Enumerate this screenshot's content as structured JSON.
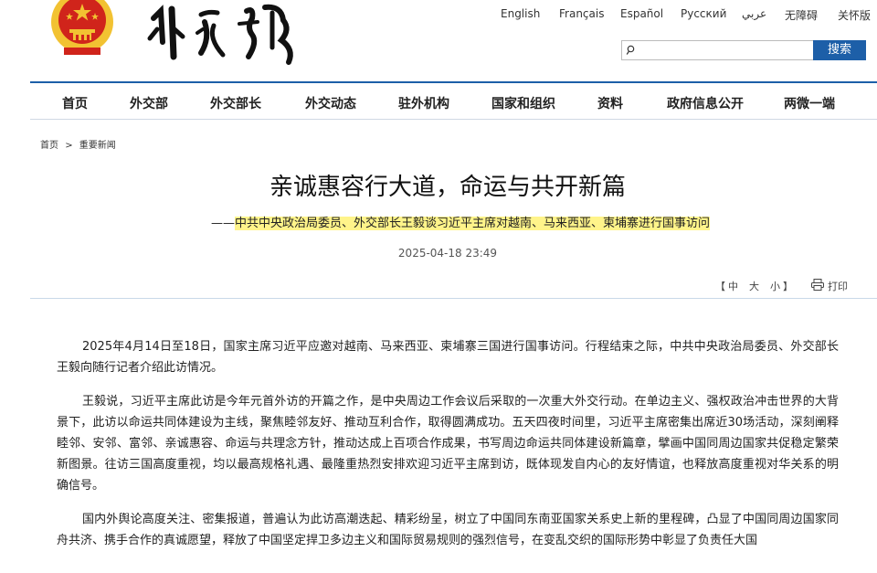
{
  "header": {
    "languages": [
      "English",
      "Français",
      "Español",
      "Русский",
      "عربي",
      "无障碍",
      "关怀版"
    ],
    "search": {
      "placeholder": "",
      "button_label": "搜索"
    }
  },
  "nav": {
    "items": [
      "首页",
      "外交部",
      "外交部长",
      "外交动态",
      "驻外机构",
      "国家和组织",
      "资料",
      "政府信息公开",
      "两微一端"
    ]
  },
  "breadcrumb": {
    "home": "首页",
    "separator": ">",
    "current": "重要新闻"
  },
  "article": {
    "title": "亲诚惠容行大道，命运与共开新篇",
    "subtitle_dash": "——",
    "subtitle": "中共中央政治局委员、外交部长王毅谈习近平主席对越南、马来西亚、柬埔寨进行国事访问",
    "date": "2025-04-18 23:49",
    "font_size_label": "【 中  大  小 】",
    "font_sizes": [
      "中",
      "大",
      "小"
    ],
    "print_label": "打印",
    "paragraphs": [
      "2025年4月14日至18日，国家主席习近平应邀对越南、马来西亚、柬埔寨三国进行国事访问。行程结束之际，中共中央政治局委员、外交部长王毅向随行记者介绍此访情况。",
      "王毅说，习近平主席此访是今年元首外访的开篇之作，是中央周边工作会议后采取的一次重大外交行动。在单边主义、强权政治冲击世界的大背景下，此访以命运共同体建设为主线，聚焦睦邻友好、推动互利合作，取得圆满成功。五天四夜时间里，习近平主席密集出席近30场活动，深刻阐释睦邻、安邻、富邻、亲诚惠容、命运与共理念方针，推动达成上百项合作成果，书写周边命运共同体建设新篇章，擘画中国同周边国家共促稳定繁荣新图景。往访三国高度重视，均以最高规格礼遇、最隆重热烈安排欢迎习近平主席到访，既体现发自内心的友好情谊，也释放高度重视对华关系的明确信号。",
      "国内外舆论高度关注、密集报道，普遍认为此访高潮迭起、精彩纷呈，树立了中国同东南亚国家关系史上新的里程碑，凸显了中国同周边国家同舟共济、携手合作的真诚愿望，释放了中国坚定捍卫多边主义和国际贸易规则的强烈信号，在变乱交织的国际形势中彰显了负责任大国"
    ]
  },
  "colors": {
    "accent": "#1d5fa8",
    "highlight": "#fff48a",
    "emblem_red": "#d0241b",
    "emblem_gold": "#f2c232"
  },
  "icons": [
    "national-emblem",
    "search-icon",
    "print-icon"
  ]
}
